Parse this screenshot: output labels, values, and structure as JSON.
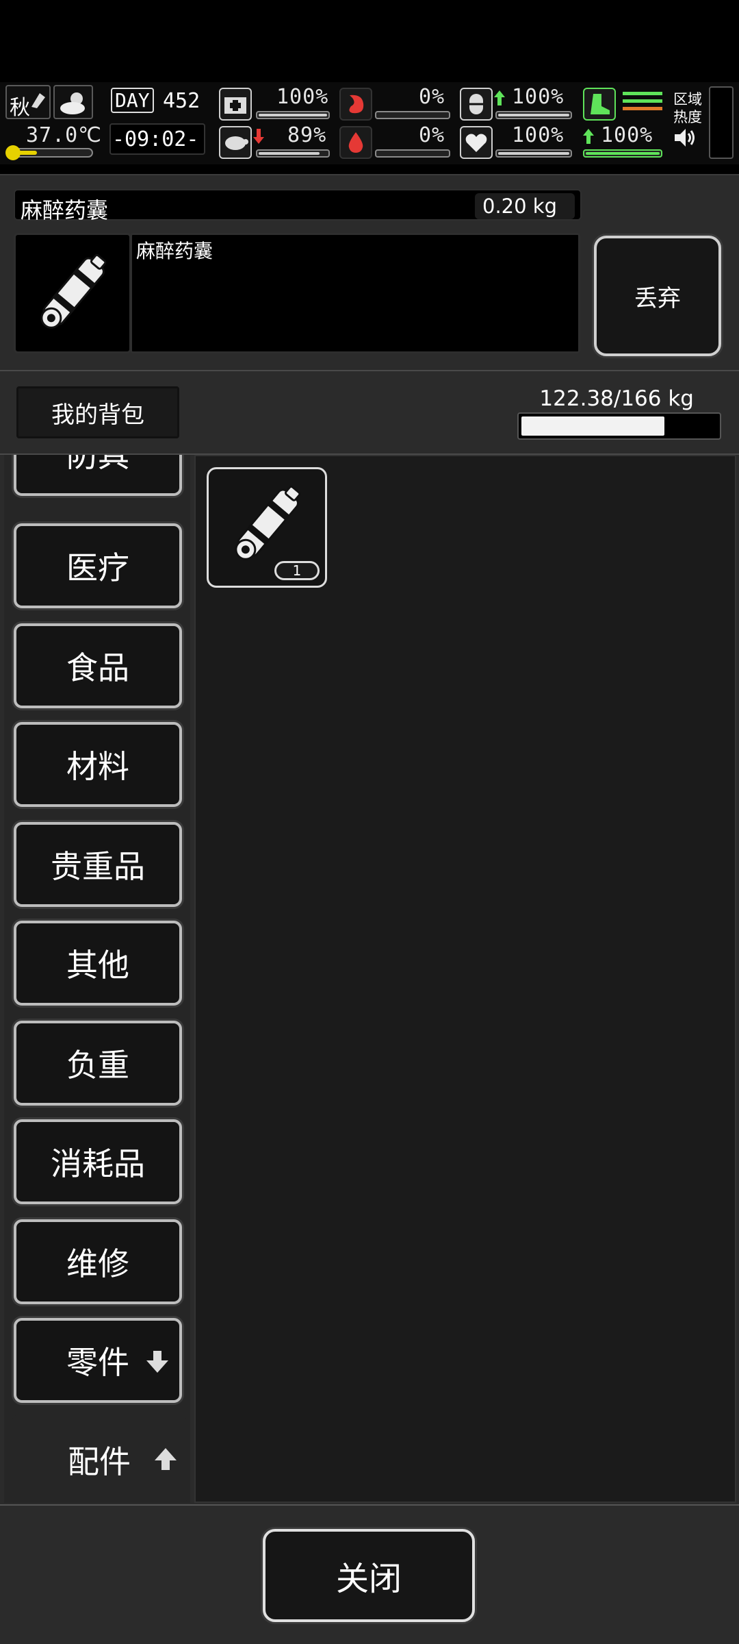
{
  "hud": {
    "season": "秋",
    "day_label": "DAY",
    "day_number": "452",
    "temperature": "37.0℃",
    "temperature_level": 0.35,
    "time": "-09:02-",
    "stats": [
      {
        "icon": "medkit-icon",
        "value": "100%",
        "level": 1.0
      },
      {
        "icon": "stomach-icon",
        "value": "0%",
        "level": 0.0
      },
      {
        "icon": "pill-icon",
        "trend": "up",
        "value": "100%",
        "level": 1.0
      },
      {
        "icon": "turtle-icon",
        "trend": "down",
        "value": "89%",
        "level": 0.89
      },
      {
        "icon": "blood-drop-icon",
        "value": "0%",
        "level": 0.0
      },
      {
        "icon": "heart-icon",
        "value": "100%",
        "level": 1.0
      }
    ],
    "stamina": {
      "trend": "up",
      "value": "100%",
      "level": 1.0
    },
    "zone_heat_label": "区域\n热度",
    "colors": {
      "green": "#5fe35a",
      "orange": "#e07a2a",
      "red": "#e53935"
    }
  },
  "detail": {
    "item_name": "麻醉药囊",
    "item_weight": "0.20 kg",
    "item_description": "麻醉药囊",
    "discard_label": "丢弃"
  },
  "bag": {
    "title": "我的背包",
    "weight": "122.38/166 kg",
    "fill_ratio": 0.737
  },
  "categories": [
    {
      "label": "防具"
    },
    {
      "label": "医疗"
    },
    {
      "label": "食品"
    },
    {
      "label": "材料"
    },
    {
      "label": "贵重品"
    },
    {
      "label": "其他"
    },
    {
      "label": "负重"
    },
    {
      "label": "消耗品"
    },
    {
      "label": "维修"
    },
    {
      "label": "零件",
      "arrow": "down"
    },
    {
      "label": "配件",
      "arrow": "up",
      "active": true
    }
  ],
  "inventory": {
    "slots": [
      {
        "item": "anesthetic-capsule-icon",
        "count": "1"
      }
    ]
  },
  "footer": {
    "close_label": "关闭"
  }
}
